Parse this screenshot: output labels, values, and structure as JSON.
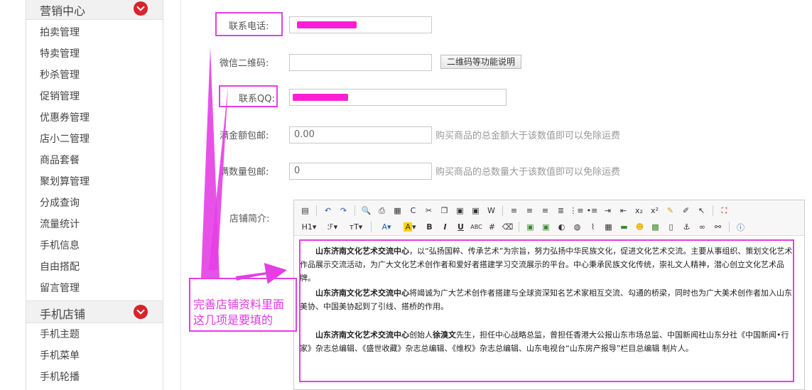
{
  "sidebar": {
    "marketing_title": "营销中心",
    "marketing_items": [
      "拍卖管理",
      "特卖管理",
      "秒杀管理",
      "促销管理",
      "优惠券管理",
      "店小二管理",
      "商品套餐",
      "聚划算管理",
      "分成查询",
      "流量统计",
      "手机信息",
      "自由搭配",
      "留言管理"
    ],
    "mobile_title": "手机店铺",
    "mobile_items": [
      "手机主题",
      "手机菜单",
      "手机轮播"
    ]
  },
  "form": {
    "phone_label": "联系电话:",
    "wechat_label": "微信二维码:",
    "wechat_button": "二维码等功能说明",
    "qq_label": "联系QQ:",
    "amount_label": "满金额包邮:",
    "amount_value": "0.00",
    "amount_hint": "购买商品的总金额大于该数值即可以免除运费",
    "qty_label": "满数量包邮:",
    "qty_value": "0",
    "qty_hint": "购买商品的总数量大于该数值即可以免除运费",
    "intro_label": "店铺简介:"
  },
  "editor": {
    "p1_bold": "山东济南文化艺术交流中心",
    "p1_rest": "，以“弘扬国粹、传承艺术”为宗旨，努力弘扬中华民族文化，促进文化艺术交流。主要从事组织、策划文化艺术作品展示交流活动，为广大文化艺术创作者和爱好者搭建学习交流展示的平台。中心秉承民族文化传统，崇礼文人精神，潜心创立文化艺术品牌。",
    "p2_bold": "山东济南文化艺术交流中心",
    "p2_rest": "将竭诚为广大艺术创作者搭建与全球资深知名艺术家相互交流、勾通的桥梁，同时也为广大美术创作者加入山东美协、中国美协起到了引线、搭桥的作用。",
    "p3_bold": "山东济南文化艺术交流中心",
    "p3_mid": "创始人",
    "p3_name": "徐溴文",
    "p3_rest": "先生，担任中心战略总监，曾担任香港大公报山东市场总监、中国新闻社山东分社《中国新闻•行家》杂志总编辑、《盛世收藏》杂志总编辑、《维权》杂志总编辑、山东电视台“山东房产报导”栏目总编辑 制片人。"
  },
  "annotation": {
    "line1": "完善店铺资料里面",
    "line2": "这几项是要填的"
  },
  "colors": {
    "highlight": "#e53ee5",
    "chevron": "#d9232d",
    "redaction": "#ff1fd2"
  }
}
